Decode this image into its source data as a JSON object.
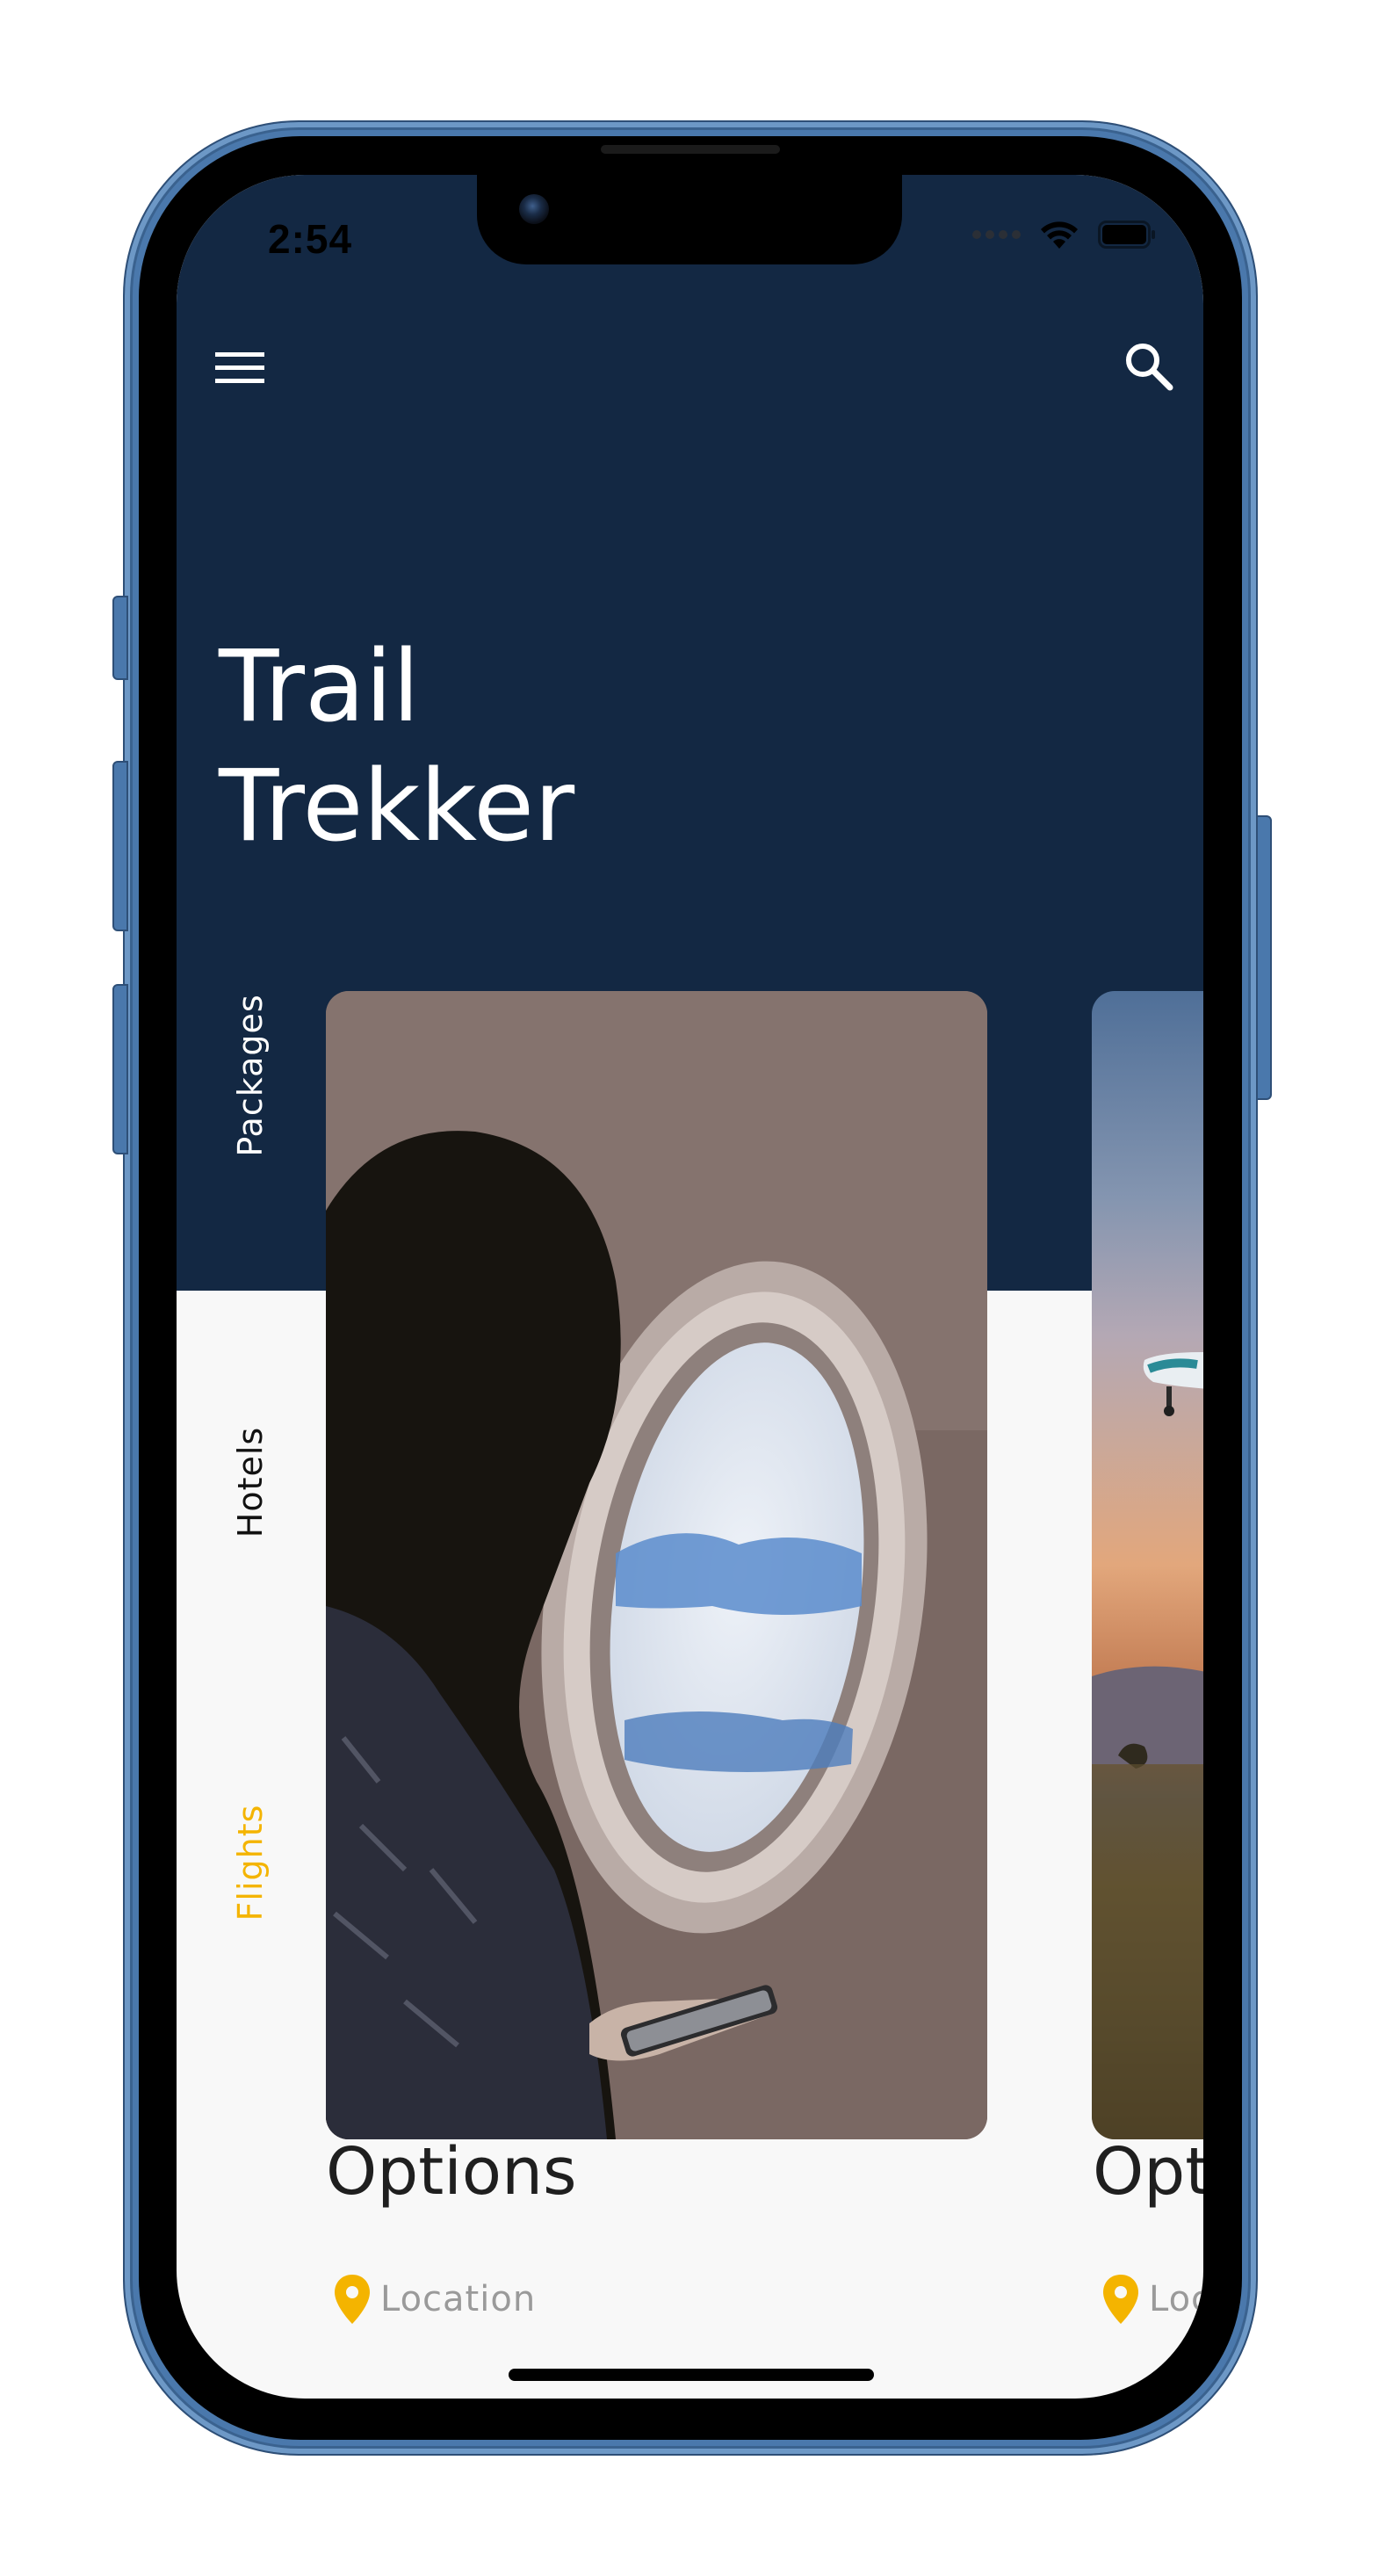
{
  "status_bar": {
    "time": "2:54"
  },
  "app": {
    "title_line1": "Trail",
    "title_line2": "Trekker"
  },
  "tabs": [
    {
      "label": "Packages",
      "state": "inactive-on-dark"
    },
    {
      "label": "Hotels",
      "state": "inactive"
    },
    {
      "label": "Flights",
      "state": "selected"
    }
  ],
  "cards": [
    {
      "title": "Options",
      "location": "Location",
      "image": "woman at airplane window"
    },
    {
      "title": "Options",
      "location": "Location",
      "image": "airplane landing at sunset"
    }
  ],
  "colors": {
    "header_bg": "#132843",
    "content_bg": "#f8f8f8",
    "accent": "#f4b400",
    "device_frame": "#4a78ac"
  },
  "icons": {
    "menu": "hamburger-menu-icon",
    "search": "search-icon",
    "location": "map-pin-icon",
    "wifi": "wifi-icon",
    "battery": "battery-icon"
  }
}
